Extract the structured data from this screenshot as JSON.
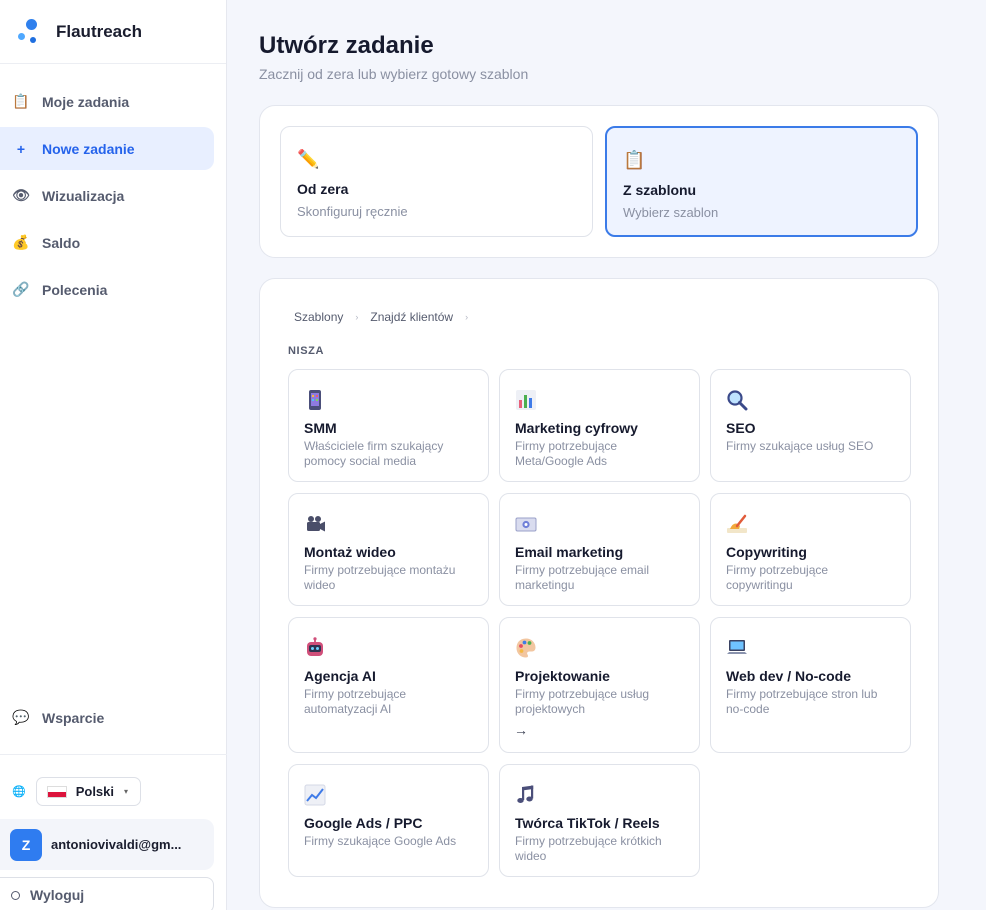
{
  "brand": {
    "name": "Flautreach"
  },
  "sidebar": {
    "items": [
      {
        "label": "Moje zadania",
        "icon": "clipboard-icon",
        "active": false
      },
      {
        "label": "Nowe zadanie",
        "icon": "plus-icon",
        "active": true
      },
      {
        "label": "Wizualizacja",
        "icon": "eye-icon",
        "active": false
      },
      {
        "label": "Saldo",
        "icon": "money-bag-icon",
        "active": false
      },
      {
        "label": "Polecenia",
        "icon": "link-icon",
        "active": false
      }
    ],
    "support_label": "Wsparcie",
    "language": "Polski",
    "user_initial": "Z",
    "user_email": "antoniovivaldi@gm...",
    "logout_label": "Wyloguj"
  },
  "page": {
    "title": "Utwórz zadanie",
    "subtitle": "Zacznij od zera lub wybierz gotowy szablon"
  },
  "modes": [
    {
      "title": "Od zera",
      "subtitle": "Skonfiguruj ręcznie",
      "icon": "pencil-icon",
      "selected": false
    },
    {
      "title": "Z szablonu",
      "subtitle": "Wybierz szablon",
      "icon": "clipboard-icon",
      "selected": true
    }
  ],
  "breadcrumb": [
    "Szablony",
    "Znajdź klientów"
  ],
  "section_label": "NISZA",
  "templates": [
    {
      "title": "SMM",
      "desc": "Właściciele firm szukający pomocy social media",
      "icon": "phone-icon"
    },
    {
      "title": "Marketing cyfrowy",
      "desc": "Firmy potrzebujące Meta/Google Ads",
      "icon": "bar-chart-icon"
    },
    {
      "title": "SEO",
      "desc": "Firmy szukające usług SEO",
      "icon": "magnifier-icon"
    },
    {
      "title": "Montaż wideo",
      "desc": "Firmy potrzebujące montażu wideo",
      "icon": "video-camera-icon"
    },
    {
      "title": "Email marketing",
      "desc": "Firmy potrzebujące email marketingu",
      "icon": "email-icon"
    },
    {
      "title": "Copywriting",
      "desc": "Firmy potrzebujące copywritingu",
      "icon": "writing-hand-icon"
    },
    {
      "title": "Agencja AI",
      "desc": "Firmy potrzebujące automatyzacji AI",
      "icon": "robot-icon"
    },
    {
      "title": "Projektowanie",
      "desc": "Firmy potrzebujące usług projektowych",
      "icon": "palette-icon",
      "arrow": "→"
    },
    {
      "title": "Web dev / No-code",
      "desc": "Firmy potrzebujące stron lub no-code",
      "icon": "laptop-icon"
    },
    {
      "title": "Google Ads / PPC",
      "desc": "Firmy szukające Google Ads",
      "icon": "trend-chart-icon"
    },
    {
      "title": "Twórca TikTok / Reels",
      "desc": "Firmy potrzebujące krótkich wideo",
      "icon": "music-note-icon"
    }
  ],
  "colors": {
    "accent": "#2563eb",
    "selected_bg": "#eef3ff",
    "selected_border": "#3b7be8"
  }
}
